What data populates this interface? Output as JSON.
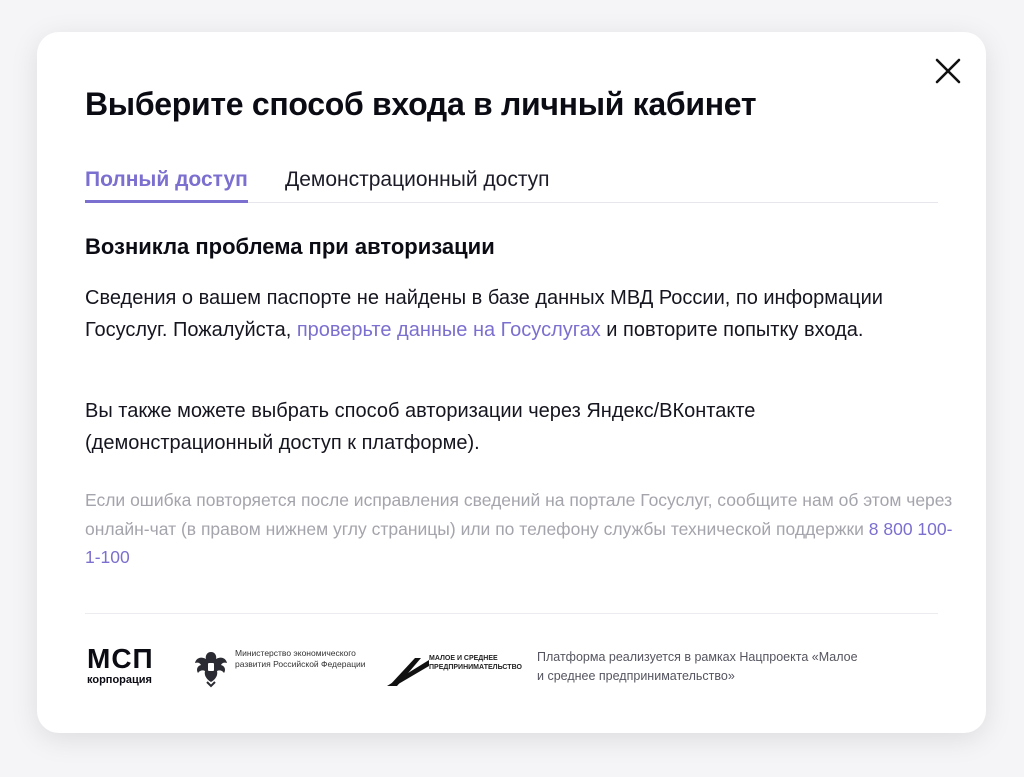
{
  "modal": {
    "title": "Выберите способ входа в личный кабинет",
    "tabs": [
      {
        "label": "Полный доступ",
        "active": true
      },
      {
        "label": "Демонстрационный доступ",
        "active": false
      }
    ],
    "heading": "Возникла проблема при авторизации",
    "paragraph1": {
      "before": "Сведения о вашем паспорте не найдены в базе данных МВД России, по информации Госуслуг. Пожалуйста, ",
      "link": "проверьте данные на Госуслугах",
      "after": " и повторите попытку входа."
    },
    "paragraph2": "Вы также можете выбрать способ авторизации через Яндекс/ВКонтакте (демонстрационный доступ к платформе).",
    "note": {
      "text": "Если ошибка повторяется после исправления сведений на портале Госуслуг, сообщите нам об этом через онлайн-чат (в правом нижнем углу страницы) или по телефону службы технической поддержки ",
      "phone": "8 800 100-1-100"
    },
    "close_icon": "close-icon"
  },
  "footer": {
    "msp_logo_big": "МСП",
    "msp_logo_small": "корпорация",
    "ministry": "Министерство экономического развития Российской Федерации",
    "mb_text": "МАЛОЕ И СРЕДНЕЕ ПРЕДПРИНИМАТЕЛЬСТВО",
    "platform_text": "Платформа реализуется в рамках Нацпроекта «Малое и среднее предпринимательство»"
  },
  "colors": {
    "accent": "#7b6fcf",
    "text": "#0b0b14",
    "muted": "#a4a4ac"
  }
}
